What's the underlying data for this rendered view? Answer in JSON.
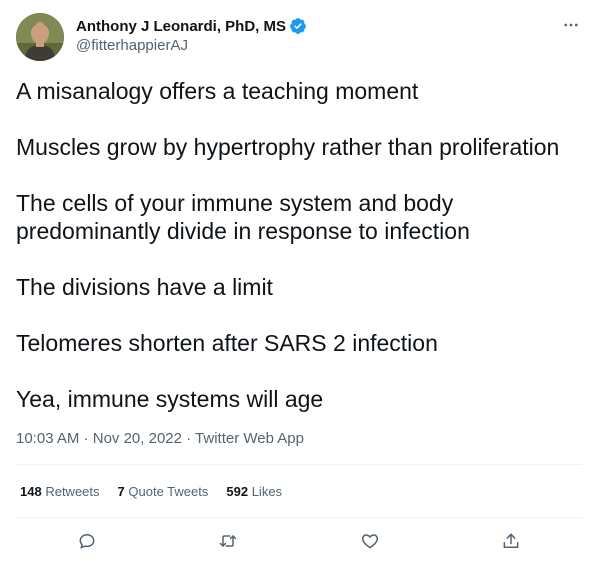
{
  "author": {
    "display_name": "Anthony J Leonardi, PhD, MS",
    "handle": "@fitterhappierAJ",
    "verified": true
  },
  "tweet": {
    "paragraphs": [
      "A misanalogy offers a teaching moment",
      "Muscles grow by hypertrophy rather than proliferation",
      "The cells of your immune system and body predominantly divide in response to infection",
      "The divisions have a limit",
      "Telomeres shorten after SARS 2 infection",
      "Yea, immune systems will age"
    ],
    "time": "10:03 AM",
    "date": "Nov 20, 2022",
    "source": "Twitter Web App",
    "separator": " · "
  },
  "stats": {
    "retweets_count": "148",
    "retweets_label": "Retweets",
    "quotes_count": "7",
    "quotes_label": "Quote Tweets",
    "likes_count": "592",
    "likes_label": "Likes"
  },
  "icons": {
    "more": "more-icon",
    "verified": "verified-badge-icon",
    "reply": "reply-icon",
    "retweet": "retweet-icon",
    "like": "like-icon",
    "share": "share-icon"
  },
  "colors": {
    "verified_blue": "#1d9bf0",
    "secondary_text": "#536471",
    "primary_text": "#0f1419",
    "divider": "#eff3f4"
  }
}
